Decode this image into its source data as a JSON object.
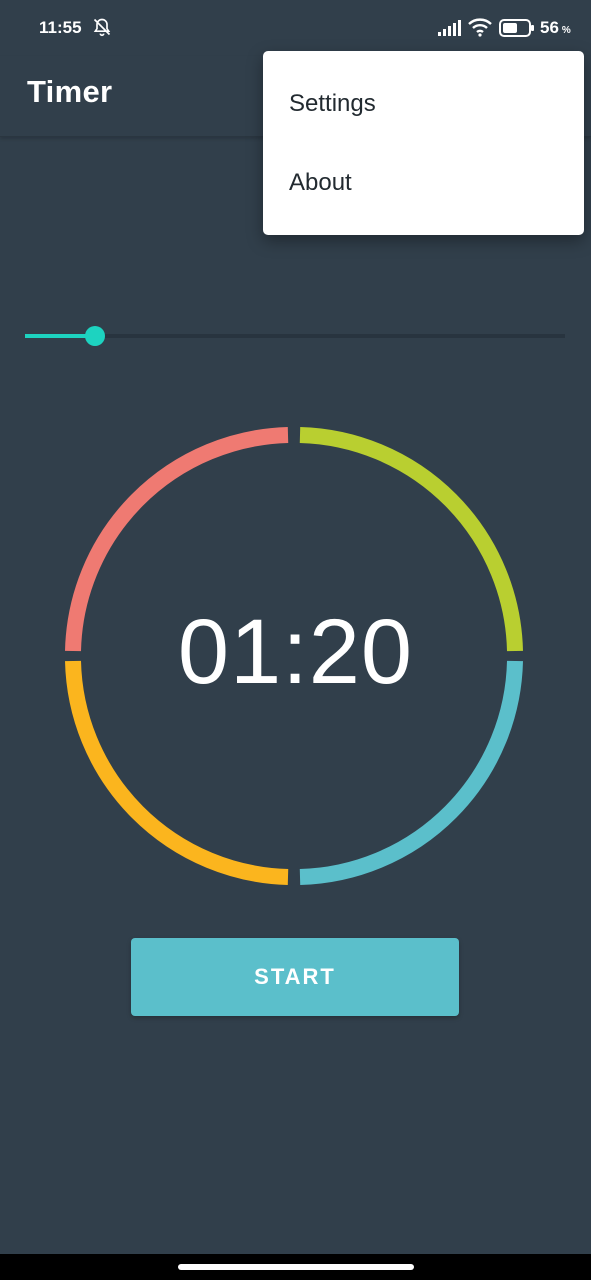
{
  "status_bar": {
    "time": "11:55",
    "battery_percent": "56",
    "battery_unit": "%",
    "icons": [
      "alarm-off-icon",
      "signal-icon",
      "wifi-icon",
      "battery-icon"
    ]
  },
  "app_bar": {
    "title": "Timer"
  },
  "overflow_menu": {
    "items": [
      {
        "label": "Settings"
      },
      {
        "label": "About"
      }
    ]
  },
  "slider": {
    "value_fraction": 0.13,
    "accent_color": "#1dd3c0"
  },
  "timer": {
    "display": "01:20",
    "segment_colors": [
      "#b9cf30",
      "#5bbfcb",
      "#fbb51e",
      "#ef7a72"
    ]
  },
  "start_button": {
    "label": "START",
    "color": "#5bbfcb"
  },
  "theme": {
    "background": "#313f4b"
  }
}
